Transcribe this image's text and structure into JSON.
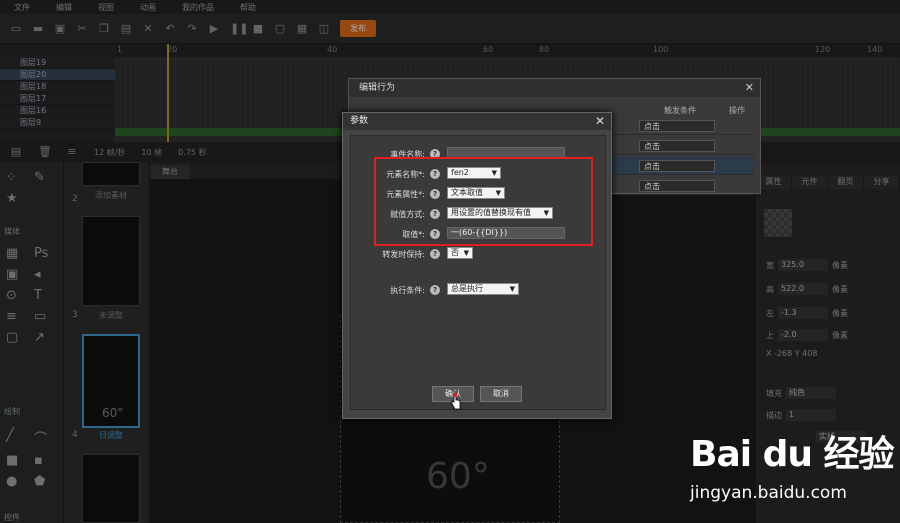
{
  "menu": {
    "items": [
      "文件",
      "编辑",
      "视图",
      "动画",
      "我的作品",
      "帮助"
    ]
  },
  "toolbar": {
    "publish": "发布"
  },
  "timeline": {
    "ruler_ticks": [
      "1",
      "20",
      "40",
      "60",
      "80",
      "100",
      "120",
      "140"
    ],
    "layers": [
      "图层19",
      "图层20",
      "图层18",
      "图层17",
      "图层16",
      "图层9"
    ],
    "footer_fps": "12 帧/秒",
    "footer_frames": "10 帧",
    "footer_time": "0.75 秒"
  },
  "tools": {
    "media_section": "媒体",
    "draw_section": "绘制",
    "control_section": "控件"
  },
  "pages": {
    "items": [
      {
        "num": "2",
        "label": "添加素材"
      },
      {
        "num": "3",
        "label": "未调整"
      },
      {
        "num": "",
        "label": "日调整"
      },
      {
        "num": "4",
        "label": ""
      }
    ],
    "thumb_text": "60°"
  },
  "stage": {
    "tab": "舞台",
    "canvas_text": "60°"
  },
  "rightpanel": {
    "tabs": [
      "属性",
      "元件",
      "翻页",
      "分享"
    ],
    "fields": [
      {
        "label": "宽",
        "value": "325.0",
        "unit": "像素"
      },
      {
        "label": "高",
        "value": "522.0",
        "unit": "像素"
      },
      {
        "label": "左",
        "value": "-1.3",
        "unit": "像素"
      },
      {
        "label": "上",
        "value": "-2.0",
        "unit": "像素"
      }
    ],
    "coords": "X -268  Y 408",
    "fill_label": "填充",
    "fill_value": "纯色",
    "stroke_label": "描边",
    "stroke_value": "1",
    "line_style": "实线"
  },
  "edit_dialog": {
    "title": "编辑行为",
    "col_trigger": "触发条件",
    "col_op": "操作",
    "rows": [
      "点击",
      "点击",
      "点击",
      "点击"
    ]
  },
  "params": {
    "title": "参数",
    "event_name_label": "事件名称:",
    "event_name_value": "",
    "element_name_label": "元素名称*:",
    "element_name_value": "fen2",
    "element_attr_label": "元素属性*:",
    "element_attr_value": "文本取值",
    "assign_label": "赋值方式:",
    "assign_value": "用设置的值替换现有值",
    "value_label": "取值*:",
    "value_value": "一(60-{{DI}})",
    "keep_label": "转发时保持:",
    "keep_value": "否",
    "exec_label": "执行条件:",
    "exec_value": "总是执行",
    "ok": "确认",
    "cancel": "取消"
  },
  "watermark": {
    "logo": "Bai du 经验",
    "url": "jingyan.baidu.com"
  },
  "colors": {
    "accent": "#e8701a",
    "highlight": "#e02020",
    "selection": "#4a9fd8"
  }
}
